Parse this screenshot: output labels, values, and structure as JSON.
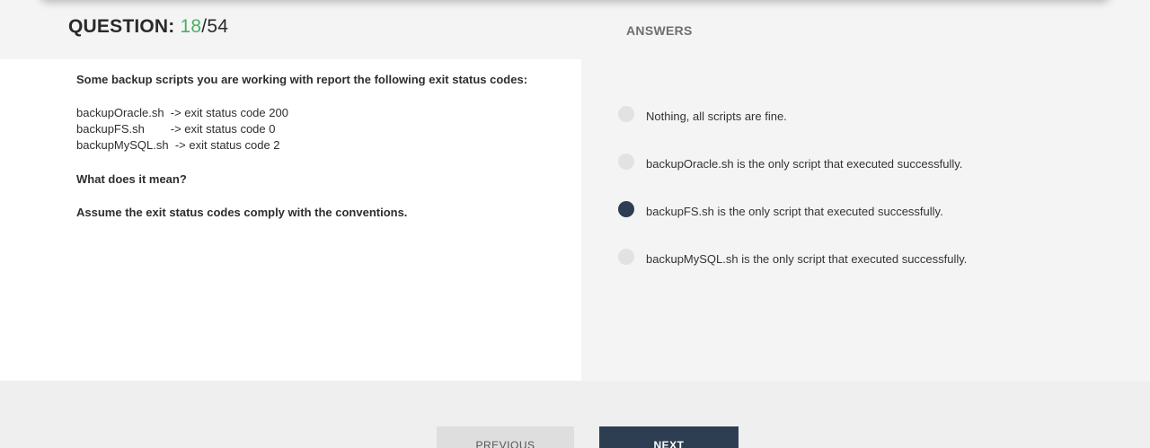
{
  "header": {
    "question_label": "QUESTION: ",
    "current": "18",
    "separator": "/",
    "total": "54",
    "answers_heading": "ANSWERS"
  },
  "question": {
    "intro": "Some backup scripts you are working with report the following exit status codes:",
    "lines": [
      "backupOracle.sh  -> exit status code 200",
      "backupFS.sh        -> exit status code 0",
      "backupMySQL.sh  -> exit status code 2"
    ],
    "prompt": "What does it mean?",
    "note": "Assume the exit status codes comply with the conventions."
  },
  "answers": [
    {
      "label": "Nothing, all scripts are fine.",
      "selected": false
    },
    {
      "label": "backupOracle.sh is the only script that executed successfully.",
      "selected": false
    },
    {
      "label": "backupFS.sh is the only script that executed successfully.",
      "selected": true
    },
    {
      "label": "backupMySQL.sh is the only script that executed successfully.",
      "selected": false
    }
  ],
  "nav": {
    "previous_label": "PREVIOUS",
    "next_label": "NEXT"
  },
  "colors": {
    "accent_green": "#4cae6a",
    "selected_radio": "#2e3e52",
    "next_button": "#2e3e52"
  }
}
